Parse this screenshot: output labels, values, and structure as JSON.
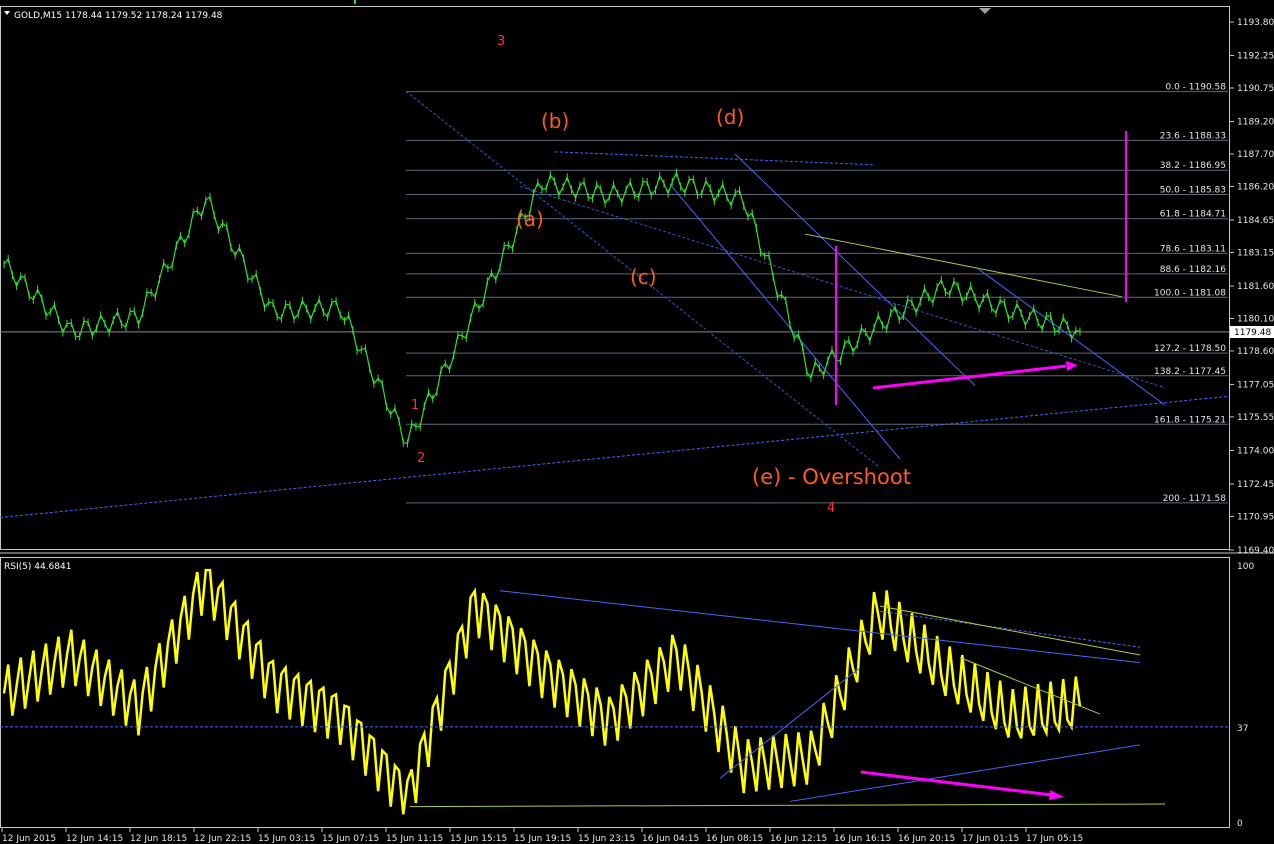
{
  "main_panel": {
    "title": "GOLD,M15  1178.44 1179.52 1178.24 1179.48",
    "y_ticks": [
      "1193.80",
      "1192.25",
      "1190.75",
      "1189.20",
      "1187.70",
      "1186.20",
      "1184.65",
      "1183.15",
      "1181.60",
      "1180.10",
      "1178.60",
      "1177.05",
      "1175.55",
      "1174.00",
      "1172.45",
      "1170.95",
      "1169.40"
    ],
    "price_badge": "1179.48",
    "fib_labels": [
      "0.0 - 1190.58",
      "23.6 - 1188.33",
      "38.2 - 1186.95",
      "50.0 - 1185.83",
      "61.8 - 1184.71",
      "78.6 - 1183.11",
      "88.6 - 1182.16",
      "100.0 - 1181.08",
      "127.2 - 1178.50",
      "138.2 - 1177.45",
      "161.8 - 1175.21",
      "200 - 1171.58"
    ],
    "big_labels": {
      "b": "(b)",
      "d": "(d)",
      "a": "(a)",
      "c": "(c)",
      "e_overshoot": "(e) - Overshoot",
      "wave3": "3",
      "wave2": "2",
      "wave4": "4",
      "wave1": "1"
    }
  },
  "rsi_panel": {
    "title": "RSI(5) 44.6841",
    "ticks": [
      "100",
      "37",
      "0"
    ]
  },
  "x_ticks": [
    "12 Jun 2015",
    "12 Jun 14:15",
    "12 Jun 18:15",
    "12 Jun 22:15",
    "15 Jun 03:15",
    "15 Jun 07:15",
    "15 Jun 11:15",
    "15 Jun 15:15",
    "15 Jun 19:15",
    "15 Jun 23:15",
    "16 Jun 04:15",
    "16 Jun 08:15",
    "16 Jun 12:15",
    "16 Jun 16:15",
    "16 Jun 20:15",
    "17 Jun 01:15",
    "17 Jun 05:15"
  ],
  "colors": {
    "background": "#000000",
    "candles": "#33dd33",
    "rsi": "#ffff00",
    "wave_big": "#ff5a1f",
    "wave_minor": "#ffa500",
    "cyan": "#22aaff",
    "magenta": "#ff00ff",
    "trendline": "#4466ff"
  },
  "chart_data": [
    {
      "type": "line",
      "title": "GOLD,M15",
      "ylim": [
        1169.4,
        1193.8
      ],
      "x": [
        "12 Jun 2015",
        "12 Jun 14:15",
        "12 Jun 18:15",
        "12 Jun 22:15",
        "15 Jun 03:15",
        "15 Jun 07:15",
        "15 Jun 11:15",
        "15 Jun 15:15",
        "15 Jun 19:15",
        "15 Jun 23:15",
        "16 Jun 04:15",
        "16 Jun 08:15",
        "16 Jun 12:15",
        "16 Jun 16:15",
        "16 Jun 20:15",
        "17 Jun 01:15",
        "17 Jun 05:15"
      ],
      "series": [
        {
          "name": "GOLD,M15",
          "values": [
            1182.6,
            1179.5,
            1180.2,
            1185.6,
            1180.4,
            1180.6,
            1174.4,
            1180.4,
            1186.4,
            1185.8,
            1186.4,
            1185.6,
            1177.5,
            1179.8,
            1181.6,
            1180.4,
            1179.5
          ]
        }
      ],
      "fib_levels": [
        1190.58,
        1188.33,
        1186.95,
        1185.83,
        1184.71,
        1183.11,
        1182.16,
        1181.08,
        1178.5,
        1177.45,
        1175.21,
        1171.58
      ],
      "last_price": 1179.48
    },
    {
      "type": "line",
      "title": "RSI(5) 44.6841",
      "ylim": [
        0,
        100
      ],
      "x": [
        "12 Jun 2015",
        "12 Jun 14:15",
        "12 Jun 18:15",
        "12 Jun 22:15",
        "15 Jun 03:15",
        "15 Jun 07:15",
        "15 Jun 11:15",
        "15 Jun 15:15",
        "15 Jun 19:15",
        "15 Jun 23:15",
        "16 Jun 04:15",
        "16 Jun 08:15",
        "16 Jun 12:15",
        "16 Jun 16:15",
        "16 Jun 20:15",
        "17 Jun 01:15",
        "17 Jun 05:15"
      ],
      "series": [
        {
          "name": "RSI(5)",
          "values": [
            50,
            65,
            45,
            95,
            55,
            42,
            10,
            85,
            60,
            40,
            65,
            22,
            25,
            82,
            58,
            40,
            45
          ]
        }
      ],
      "level": 37,
      "last_value": 44.6841
    }
  ]
}
